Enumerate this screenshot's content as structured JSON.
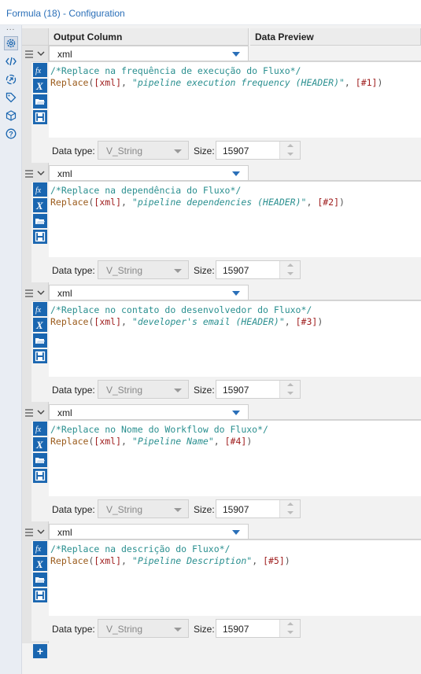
{
  "window": {
    "title": "Formula (18) - Configuration"
  },
  "sidebar": {
    "more": "...",
    "icons": [
      "gear-icon",
      "code-icon",
      "connect-icon",
      "tag-icon",
      "cube-icon",
      "help-icon"
    ]
  },
  "header": {
    "output_column": "Output Column",
    "data_preview": "Data Preview"
  },
  "labels": {
    "data_type": "Data type:",
    "size": "Size:"
  },
  "formulas": [
    {
      "column": "xml",
      "comment": "/*Replace na frequência de execução do Fluxo*/",
      "fn": "Replace",
      "field": "[xml]",
      "string": "\"pipeline execution frequency (HEADER)\"",
      "param": "[#1]",
      "data_type": "V_String",
      "size": "15907"
    },
    {
      "column": "xml",
      "comment": "/*Replace na dependência do Fluxo*/",
      "fn": "Replace",
      "field": "[xml]",
      "string": "\"pipeline dependencies (HEADER)\"",
      "param": "[#2]",
      "data_type": "V_String",
      "size": "15907"
    },
    {
      "column": "xml",
      "comment": "/*Replace no contato do desenvolvedor do Fluxo*/",
      "fn": "Replace",
      "field": "[xml]",
      "string": "\"developer's email (HEADER)\"",
      "param": "[#3]",
      "data_type": "V_String",
      "size": "15907"
    },
    {
      "column": "xml",
      "comment": "/*Replace no Nome do Workflow do Fluxo*/",
      "fn": "Replace",
      "field": "[xml]",
      "string": "\"Pipeline Name\"",
      "param": "[#4]",
      "data_type": "V_String",
      "size": "15907"
    },
    {
      "column": "xml",
      "comment": "/*Replace na descrição do Fluxo*/",
      "fn": "Replace",
      "field": "[xml]",
      "string": "\"Pipeline Description\"",
      "param": "[#5]",
      "data_type": "V_String",
      "size": "15907"
    }
  ],
  "add_button": "+",
  "colors": {
    "accent": "#1a66b0",
    "title": "#2a6fb8",
    "comment": "#2a8f8f",
    "function": "#9a5a1a",
    "field": "#a02020"
  }
}
